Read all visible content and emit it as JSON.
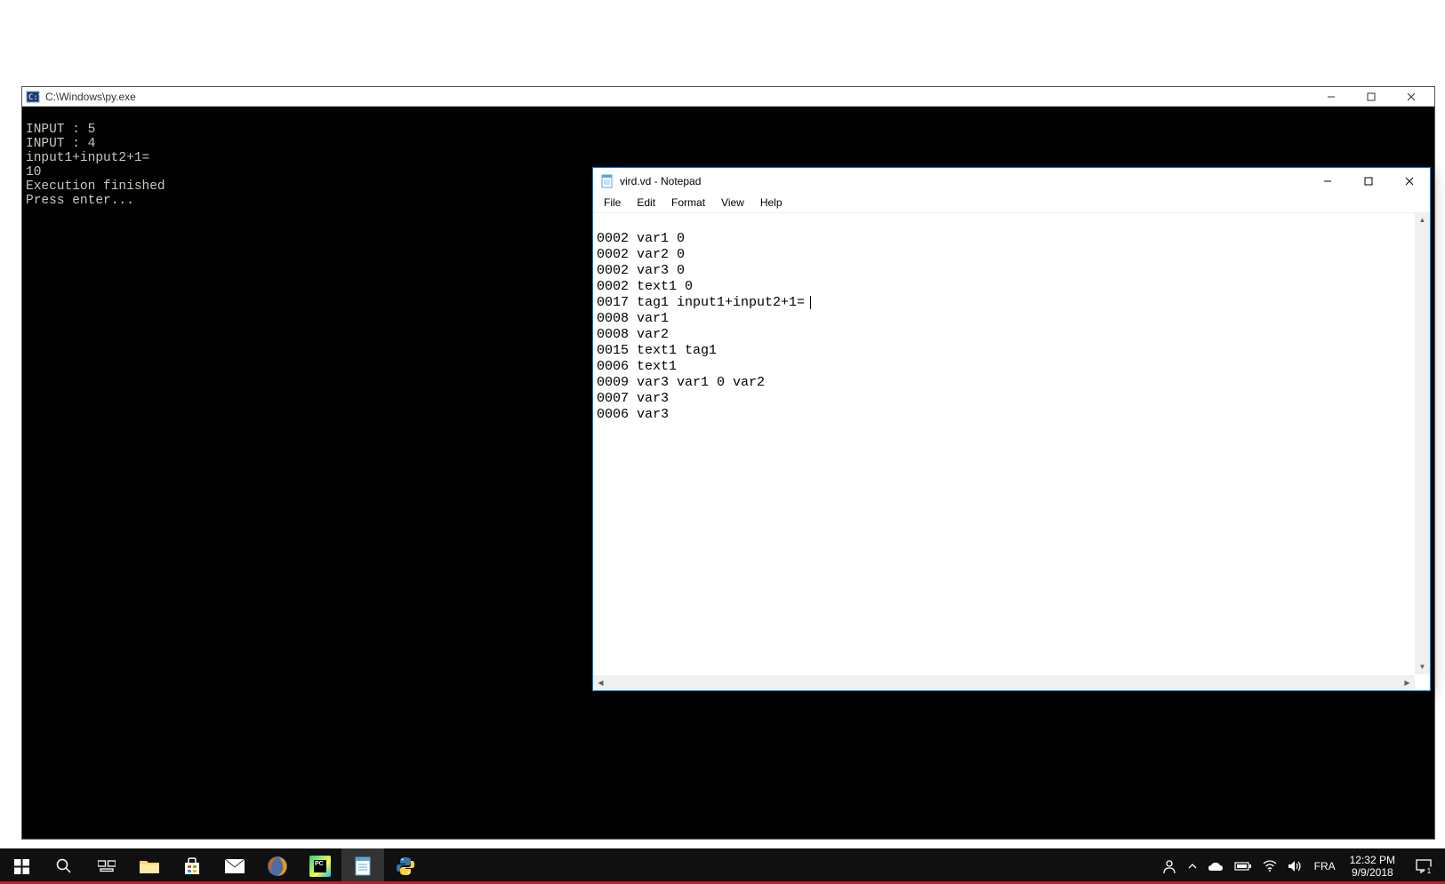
{
  "console": {
    "title": "C:\\Windows\\py.exe",
    "lines": [
      "INPUT : 5",
      "INPUT : 4",
      "input1+input2+1=",
      "10",
      "Execution finished",
      "Press enter..."
    ]
  },
  "notepad": {
    "title": "vird.vd - Notepad",
    "menus": {
      "file": "File",
      "edit": "Edit",
      "format": "Format",
      "view": "View",
      "help": "Help"
    },
    "lines": [
      "0002 var1 0",
      "0002 var2 0",
      "0002 var3 0",
      "0002 text1 0",
      "0017 tag1 input1+input2+1=",
      "0008 var1",
      "0008 var2",
      "0015 text1 tag1",
      "0006 text1",
      "0009 var3 var1 0 var2",
      "0007 var3",
      "0006 var3"
    ],
    "cursor_line_index": 4
  },
  "taskbar": {
    "lang": "FRA",
    "time": "12:32 PM",
    "date": "9/9/2018",
    "notif_count": "1"
  }
}
